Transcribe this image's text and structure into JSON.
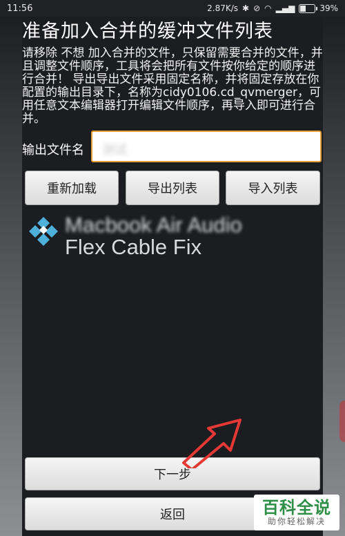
{
  "status_bar": {
    "time": "11:56",
    "network_speed": "2.87K/s",
    "battery_percent": "39%"
  },
  "screen": {
    "title": "准备加入合并的缓冲文件列表",
    "description": "请移除 不想 加入合并的文件，只保留需要合并的文件，并且调整文件顺序，工具将会把所有文件按你给定的顺序进行合并！ 导出导出文件采用固定名称，并将固定存放在你配置的输出目录下，名称为cidy0106.cd_qvmerger，可用任意文本编辑器打开编辑文件顺序，再导入即可进行合并。"
  },
  "output": {
    "label": "输出文件名",
    "value": "测试"
  },
  "toolbar": {
    "reload": "重新加载",
    "export": "导出列表",
    "import": "导入列表"
  },
  "file_list": [
    {
      "line1": "Macbook Air Audio",
      "line2": "Flex Cable Fix"
    }
  ],
  "footer": {
    "next": "下一步",
    "back": "返回"
  },
  "watermark": {
    "main": "百科全说",
    "sub": "助你轻松解决"
  },
  "colors": {
    "accent_border": "#e6a13a",
    "arrow": "#e53935",
    "kite": "#4fb0dc"
  }
}
